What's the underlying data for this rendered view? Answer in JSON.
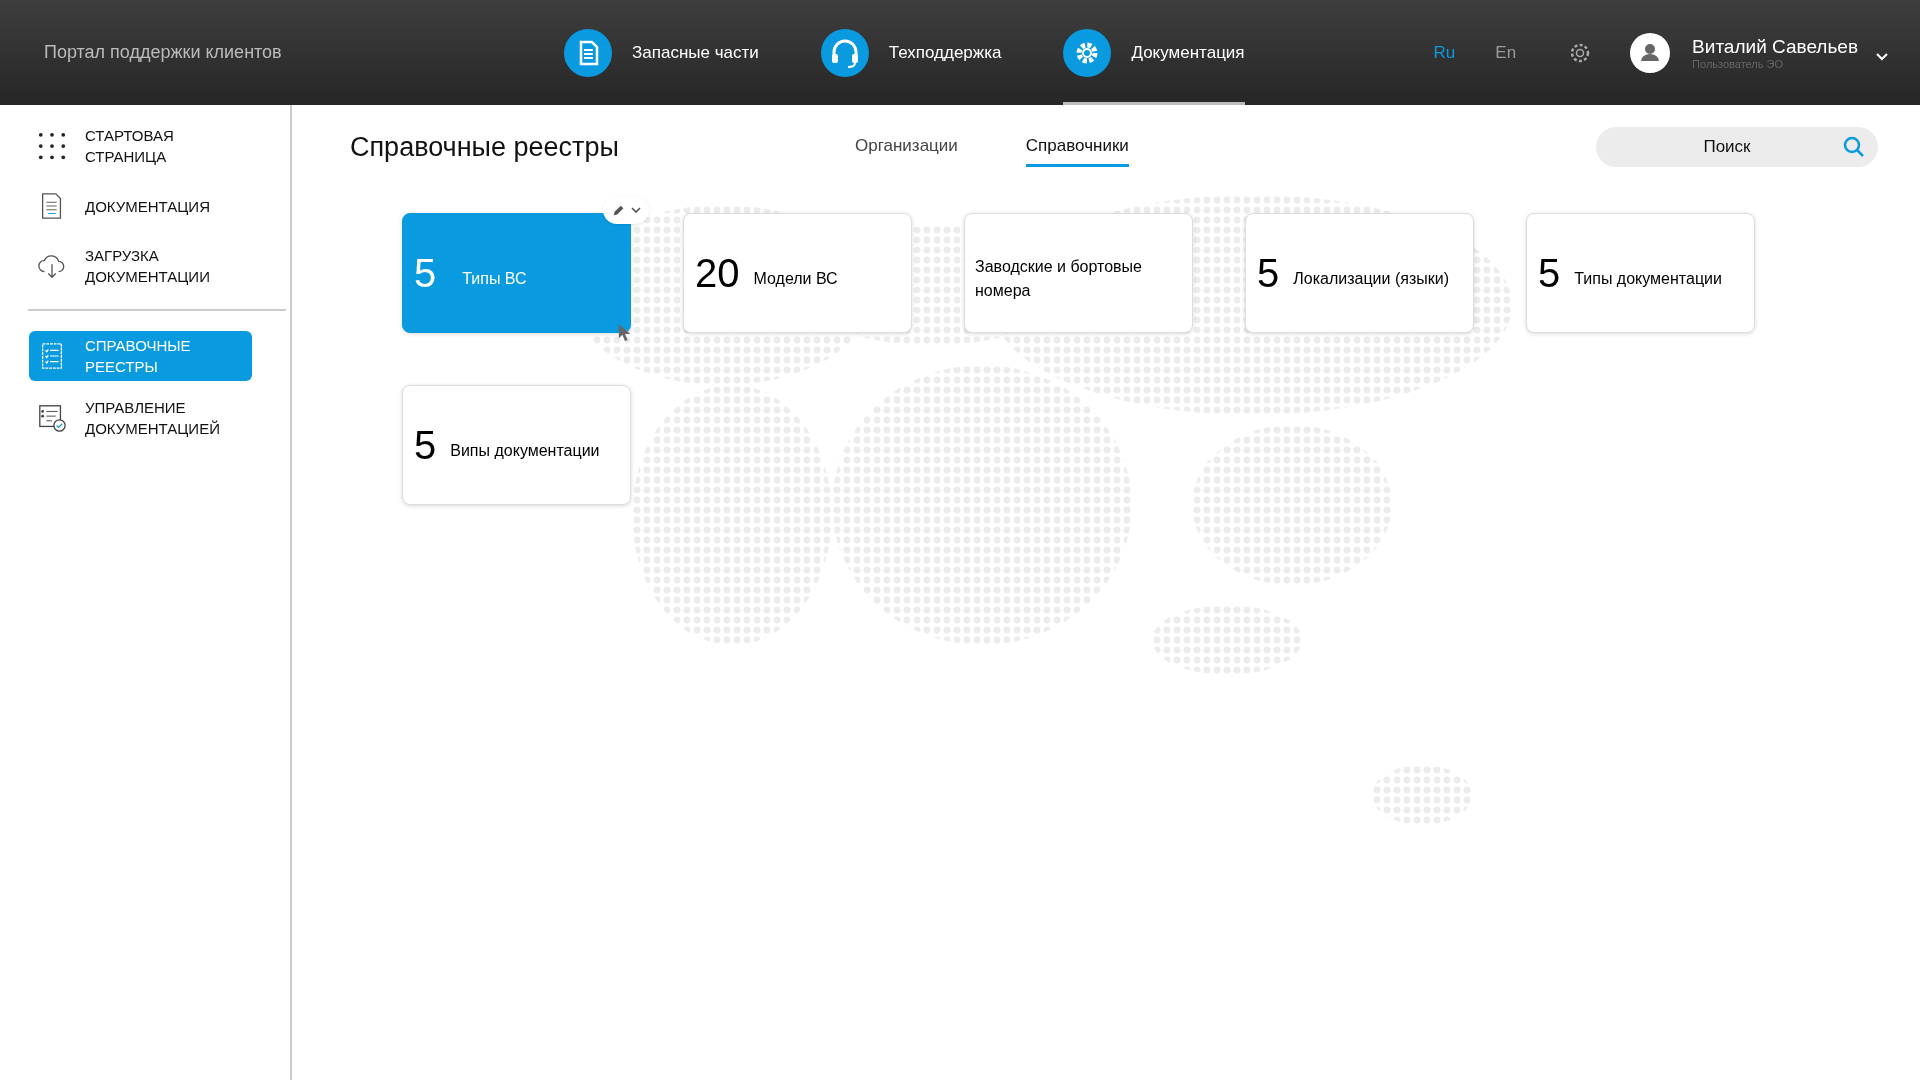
{
  "header": {
    "portal_title": "Портал поддержки клиентов",
    "nav": [
      {
        "label": "Запасные части",
        "kind": "parts",
        "selected": false
      },
      {
        "label": "Техподдержка",
        "kind": "support",
        "selected": false
      },
      {
        "label": "Документация",
        "kind": "docs",
        "selected": true
      }
    ],
    "languages": [
      {
        "label": "Ru",
        "selected": true
      },
      {
        "label": "En",
        "selected": false
      }
    ],
    "user": {
      "name": "Виталий Савельев",
      "role": "Пользователь ЭО"
    }
  },
  "sidebar": {
    "items": [
      {
        "label": "СТАРТОВАЯ СТРАНИЦА",
        "kind": "grid",
        "selected": false
      },
      {
        "label": "ДОКУМЕНТАЦИЯ",
        "kind": "doc",
        "selected": false
      },
      {
        "label": "ЗАГРУЗКА ДОКУМЕНТАЦИИ",
        "kind": "upload",
        "selected": false
      },
      {
        "label": "СПРАВОЧНЫЕ РЕЕСТРЫ",
        "kind": "registry",
        "selected": true
      },
      {
        "label": "УПРАВЛЕНИЕ ДОКУМЕНТАЦИЕЙ",
        "kind": "manage",
        "selected": false
      }
    ]
  },
  "page": {
    "title": "Справочные реестры",
    "tabs": [
      {
        "label": "Организации",
        "selected": false
      },
      {
        "label": "Справочники",
        "selected": true
      }
    ],
    "search": {
      "placeholder": "Поиск"
    },
    "cards": [
      {
        "count": "5",
        "label": "Типы ВС",
        "selected": true
      },
      {
        "count": "20",
        "label": "Модели ВС",
        "selected": false
      },
      {
        "label": "Заводские и бортовые номера",
        "selected": false
      },
      {
        "count": "5",
        "label": "Локализации (языки)",
        "selected": false
      },
      {
        "count": "5",
        "label": "Типы документации",
        "selected": false
      },
      {
        "count": "5",
        "label": "Випы документации",
        "selected": false
      }
    ]
  }
}
